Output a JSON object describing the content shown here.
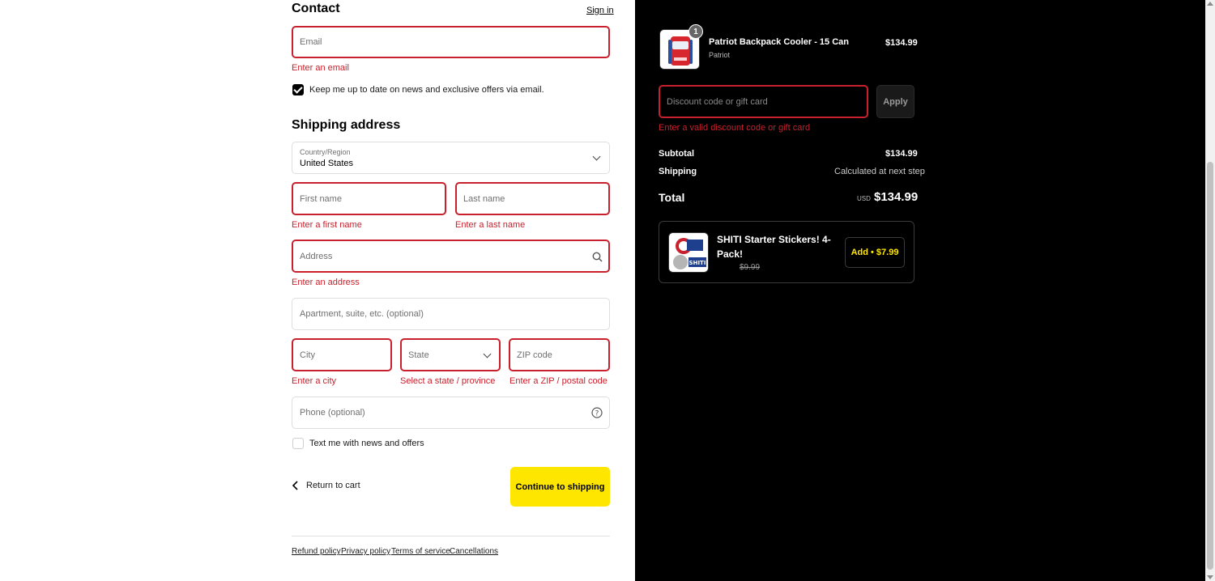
{
  "contact": {
    "heading": "Contact",
    "sign_in": "Sign in",
    "email_placeholder": "Email",
    "email_error": "Enter an email",
    "newsletter_label": "Keep me up to date on news and exclusive offers via email."
  },
  "shipping": {
    "heading": "Shipping address",
    "country_label": "Country/Region",
    "country_value": "United States",
    "first_name_placeholder": "First name",
    "first_name_error": "Enter a first name",
    "last_name_placeholder": "Last name",
    "last_name_error": "Enter a last name",
    "address_placeholder": "Address",
    "address_error": "Enter an address",
    "apartment_placeholder": "Apartment, suite, etc. (optional)",
    "city_placeholder": "City",
    "city_error": "Enter a city",
    "state_placeholder": "State",
    "state_error": "Select a state / province",
    "zip_placeholder": "ZIP code",
    "zip_error": "Enter a ZIP / postal code",
    "phone_placeholder": "Phone (optional)",
    "sms_label": "Text me with news and offers"
  },
  "actions": {
    "return_to_cart": "Return to cart",
    "continue": "Continue to shipping"
  },
  "footer": {
    "links": [
      "Refund policy",
      "Privacy policy",
      "Terms of service",
      "Cancellations"
    ]
  },
  "summary": {
    "product": {
      "name": "Patriot Backpack Cooler - 15 Can",
      "variant": "Patriot",
      "price": "$134.99",
      "quantity": "1"
    },
    "discount_placeholder": "Discount code or gift card",
    "apply_label": "Apply",
    "discount_error": "Enter a valid discount code or gift card",
    "subtotal_label": "Subtotal",
    "subtotal_value": "$134.99",
    "shipping_label": "Shipping",
    "shipping_value": "Calculated at next step",
    "total_label": "Total",
    "currency": "USD",
    "total_value": "$134.99",
    "upsell": {
      "name_line1": "SHITI Starter Stickers! 4-",
      "name_line2": "Pack!",
      "original_price": "$9.99",
      "add_label": "Add • $7.99"
    }
  },
  "colors": {
    "error": "#c8202c",
    "accent_yellow": "#ffe600",
    "dark_bg": "#000000"
  }
}
